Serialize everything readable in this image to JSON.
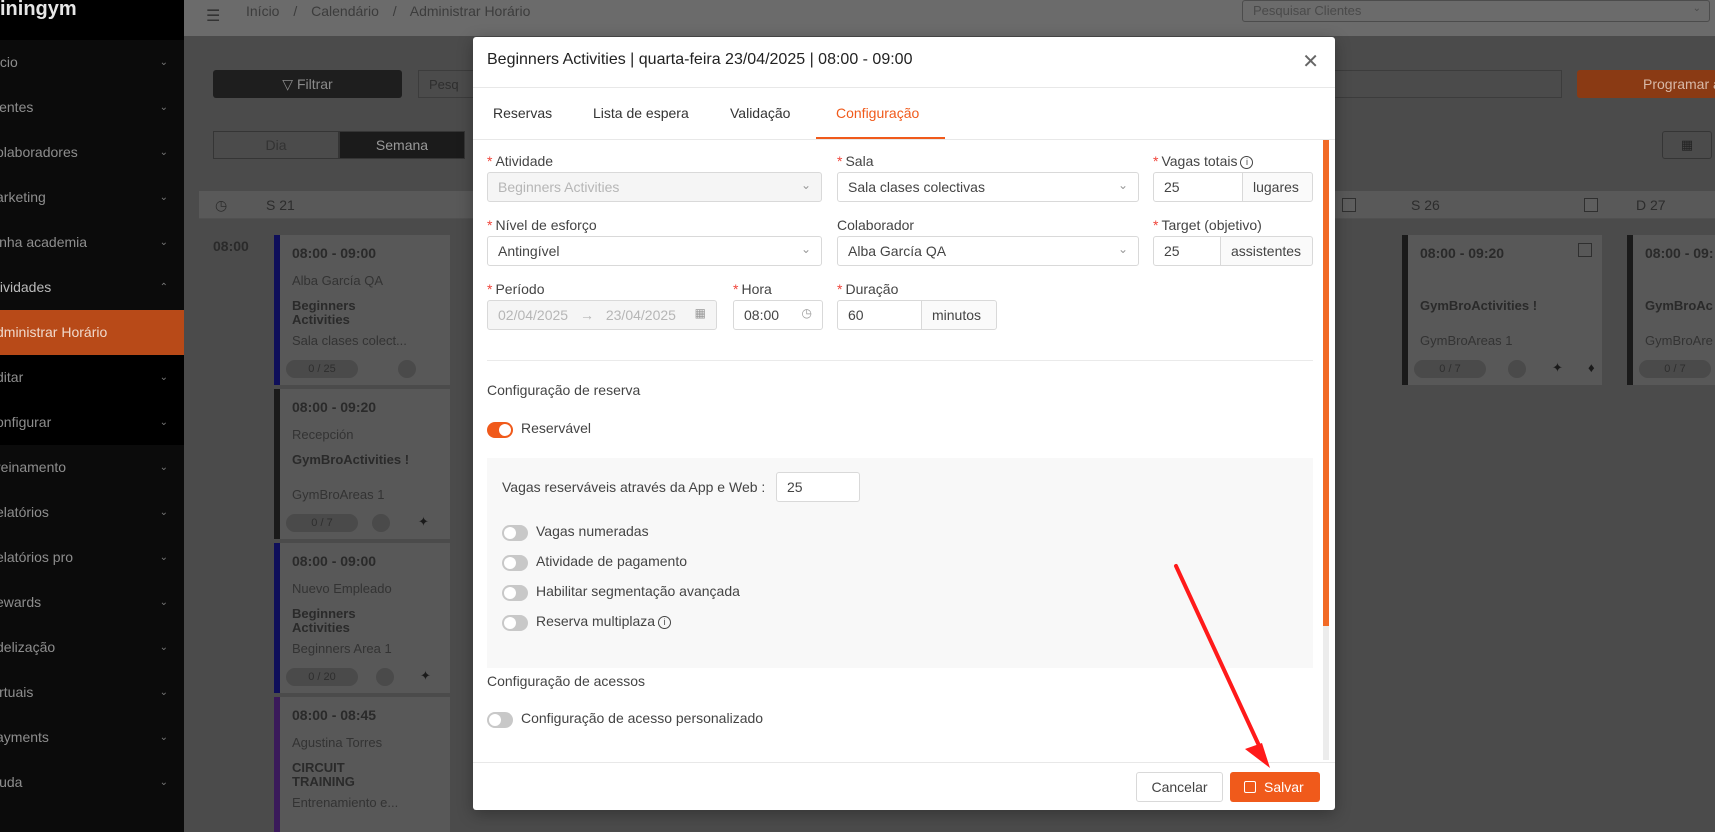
{
  "sidebar": {
    "logo": "iningym",
    "items": [
      {
        "label": "ício"
      },
      {
        "label": "ientes"
      },
      {
        "label": "olaboradores"
      },
      {
        "label": "arketing"
      },
      {
        "label": "inha academia"
      },
      {
        "label": "tividades"
      },
      {
        "label": "dministrar Horário"
      },
      {
        "label": "ditar"
      },
      {
        "label": "onfigurar"
      },
      {
        "label": "reinamento"
      },
      {
        "label": "elatórios"
      },
      {
        "label": "elatórios pro"
      },
      {
        "label": "ewards"
      },
      {
        "label": "delização"
      },
      {
        "label": "irtuais"
      },
      {
        "label": "ayments"
      },
      {
        "label": "juda"
      }
    ]
  },
  "topbar": {
    "breadcrumb": [
      "Início",
      "/",
      "Calendário",
      "/",
      "Administrar Horário"
    ],
    "search_placeholder": "Pesquisar Clientes"
  },
  "toolbar": {
    "filter_label": "Filtrar",
    "search_placeholder": "Pesq",
    "program_label": "Programar a",
    "view_day": "Dia",
    "view_week": "Semana"
  },
  "calendar": {
    "columns": [
      "S 21",
      "S 26",
      "D 27"
    ],
    "time_label": "08:00",
    "events": [
      {
        "time": "08:00 - 09:00",
        "staff": "Alba García QA",
        "name": "Beginners Activities",
        "room": "Sala clases colect...",
        "count": "0 / 25"
      },
      {
        "time": "08:00 - 09:20",
        "staff": "Recepción",
        "name": "GymBroActivities !",
        "room": "GymBroAreas 1",
        "count": "0 / 7"
      },
      {
        "time": "08:00 - 09:00",
        "staff": "Nuevo Empleado",
        "name": "Beginners Activities",
        "room": "Beginners Area 1",
        "count": "0 / 20"
      },
      {
        "time": "08:00 - 08:45",
        "staff": "Agustina Torres",
        "name": "CIRCUIT TRAINING",
        "room": "Entrenamiento e..."
      },
      {
        "time": "08:00 - 09:20",
        "name": "GymBroActivities !",
        "room": "GymBroAreas 1",
        "count": "0 / 7"
      },
      {
        "time": "08:00 - 09:",
        "name": "GymBroAc",
        "room": "GymBroAre",
        "count": "0 / 7"
      }
    ]
  },
  "modal": {
    "title": "Beginners Activities | quarta-feira 23/04/2025 | 08:00 - 09:00",
    "tabs": [
      "Reservas",
      "Lista de espera",
      "Validação",
      "Configuração"
    ],
    "active_tab": 3,
    "fields": {
      "atividade": {
        "label": "Atividade",
        "value": "Beginners Activities"
      },
      "sala": {
        "label": "Sala",
        "value": "Sala clases colectivas"
      },
      "vagas_totais": {
        "label": "Vagas totais",
        "value": "25",
        "unit": "lugares"
      },
      "nivel": {
        "label": "Nível de esforço",
        "value": "Antingível"
      },
      "colaborador": {
        "label": "Colaborador",
        "value": "Alba García QA"
      },
      "target": {
        "label": "Target (objetivo)",
        "value": "25",
        "unit": "assistentes"
      },
      "periodo": {
        "label": "Período",
        "start": "02/04/2025",
        "end": "23/04/2025"
      },
      "hora": {
        "label": "Hora",
        "value": "08:00"
      },
      "duracao": {
        "label": "Duração",
        "value": "60",
        "unit": "minutos"
      }
    },
    "booking_section": {
      "title": "Configuração de reserva",
      "reservavel_label": "Reservável",
      "reservavel_on": true,
      "app_web_label": "Vagas reserváveis através da App e Web",
      "app_web_value": "25",
      "toggles": [
        {
          "label": "Vagas numeradas",
          "on": false
        },
        {
          "label": "Atividade de pagamento",
          "on": false
        },
        {
          "label": "Habilitar segmentação avançada",
          "on": false
        },
        {
          "label": "Reserva multiplaza",
          "on": false
        }
      ]
    },
    "access_section": {
      "title": "Configuração de acessos",
      "custom_label": "Configuração de acesso personalizado",
      "custom_on": false
    },
    "footer": {
      "cancel_label": "Cancelar",
      "save_label": "Salvar"
    }
  },
  "colors": {
    "accent": "#f05a1b",
    "annotation_arrow": "#ff1a1a"
  }
}
